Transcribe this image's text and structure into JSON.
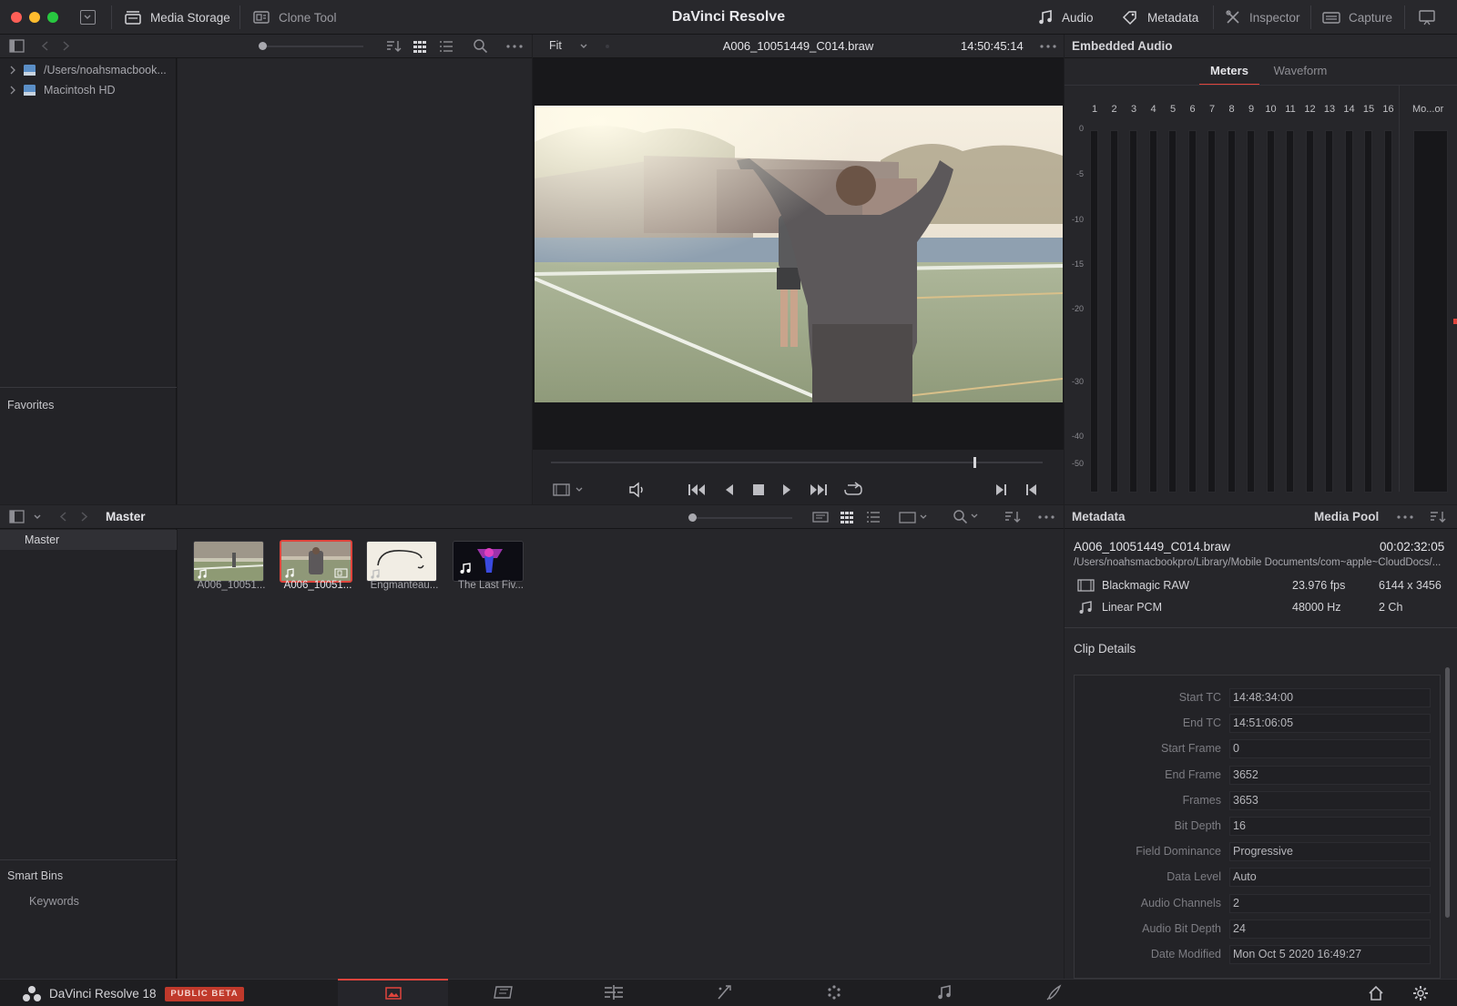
{
  "app": {
    "title": "DaVinci Resolve",
    "toolbar": {
      "media_storage": "Media Storage",
      "clone_tool": "Clone Tool",
      "audio": "Audio",
      "metadata": "Metadata",
      "inspector": "Inspector",
      "capture": "Capture"
    }
  },
  "storage": {
    "items": [
      {
        "label": "/Users/noahsmacbook..."
      },
      {
        "label": "Macintosh HD"
      }
    ],
    "favorites_label": "Favorites"
  },
  "viewer": {
    "zoom": "Fit",
    "clip_name": "A006_10051449_C014.braw",
    "timecode": "14:50:45:14",
    "scrub_position": 0.86
  },
  "audio_panel": {
    "title": "Embedded Audio",
    "tabs": [
      {
        "label": "Meters",
        "active": true
      },
      {
        "label": "Waveform",
        "active": false
      }
    ],
    "channels": [
      "1",
      "2",
      "3",
      "4",
      "5",
      "6",
      "7",
      "8",
      "9",
      "10",
      "11",
      "12",
      "13",
      "14",
      "15",
      "16"
    ],
    "monitor_label": "Mo...or",
    "scale": [
      "0",
      "-5",
      "-10",
      "-15",
      "-20",
      "-30",
      "-40",
      "-50"
    ]
  },
  "media_pool": {
    "breadcrumb": "Master",
    "bins": [
      {
        "label": "Master"
      }
    ],
    "smart_bins_label": "Smart Bins",
    "smart_bins": [
      {
        "label": "Keywords"
      }
    ],
    "clips": [
      {
        "label": "A006_10051...",
        "selected": false
      },
      {
        "label": "A006_10051...",
        "selected": true
      },
      {
        "label": "Engmanteau...",
        "selected": false
      },
      {
        "label": "The Last Fiv...",
        "selected": false
      }
    ]
  },
  "metadata_panel": {
    "title": "Metadata",
    "source": "Media Pool",
    "clip_name": "A006_10051449_C014.braw",
    "duration": "00:02:32:05",
    "path": "/Users/noahsmacbookpro/Library/Mobile Documents/com~apple~CloudDocs/...",
    "video": {
      "codec": "Blackmagic RAW",
      "fps": "23.976 fps",
      "resolution": "6144 x 3456"
    },
    "audio": {
      "codec": "Linear PCM",
      "rate": "48000 Hz",
      "channels": "2 Ch"
    },
    "section": "Clip Details",
    "fields": [
      {
        "label": "Start TC",
        "value": "14:48:34:00"
      },
      {
        "label": "End TC",
        "value": "14:51:06:05"
      },
      {
        "label": "Start Frame",
        "value": "0"
      },
      {
        "label": "End Frame",
        "value": "3652"
      },
      {
        "label": "Frames",
        "value": "3653"
      },
      {
        "label": "Bit Depth",
        "value": "16"
      },
      {
        "label": "Field Dominance",
        "value": "Progressive"
      },
      {
        "label": "Data Level",
        "value": "Auto"
      },
      {
        "label": "Audio Channels",
        "value": "2"
      },
      {
        "label": "Audio Bit Depth",
        "value": "24"
      },
      {
        "label": "Date Modified",
        "value": "Mon Oct 5 2020 16:49:27"
      }
    ]
  },
  "footer": {
    "app_name": "DaVinci Resolve 18",
    "badge": "PUBLIC BETA"
  },
  "colors": {
    "accent_red": "#e0443c",
    "badge_red": "#c0392b",
    "panel_bg": "#232327",
    "toolbar_bg": "#28282c"
  }
}
